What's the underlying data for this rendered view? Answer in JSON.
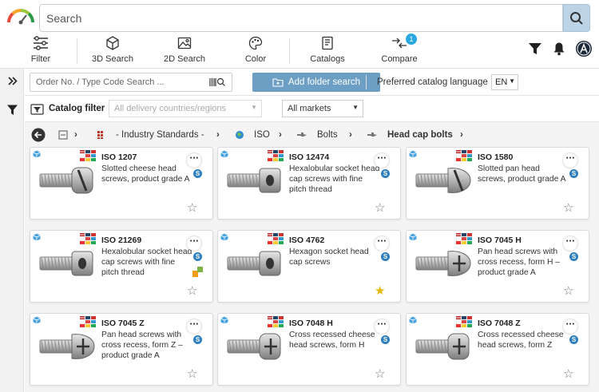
{
  "header": {
    "search_placeholder": "Search"
  },
  "toolbar": {
    "filter": "Filter",
    "search3d": "3D Search",
    "search2d": "2D Search",
    "color": "Color",
    "catalogs": "Catalogs",
    "compare": "Compare",
    "compare_count": "1"
  },
  "order": {
    "placeholder": "Order No. / Type Code Search ..."
  },
  "add_folder": "Add folder search",
  "pref_lang_label": "Preferred catalog language",
  "lang_value": "EN",
  "catalog_filter": {
    "label": "Catalog filter",
    "countries": "All delivery countries/regions",
    "markets": "All markets"
  },
  "breadcrumb": {
    "industry": "- Industry Standards -",
    "iso": "ISO",
    "bolts": "Bolts",
    "current": "Head cap bolts"
  },
  "cards": [
    {
      "title": "ISO 1207",
      "desc": "Slotted cheese head screws, product grade A",
      "head": "cheese-slot",
      "favorite": false,
      "extra_badge": false
    },
    {
      "title": "ISO 12474",
      "desc": "Hexalobular socket head cap screws with fine pitch thread",
      "head": "socket",
      "favorite": false,
      "extra_badge": false
    },
    {
      "title": "ISO 1580",
      "desc": "Slotted pan head screws, product grade A",
      "head": "pan-slot",
      "favorite": false,
      "extra_badge": false
    },
    {
      "title": "ISO 21269",
      "desc": "Hexalobular socket head cap screws with fine pitch thread",
      "head": "socket",
      "favorite": false,
      "extra_badge": true
    },
    {
      "title": "ISO 4762",
      "desc": "Hexagon socket head cap screws",
      "head": "socket",
      "favorite": true,
      "extra_badge": false
    },
    {
      "title": "ISO 7045 H",
      "desc": "Pan head screws with cross recess, form H – product grade A",
      "head": "pan-cross",
      "favorite": false,
      "extra_badge": false
    },
    {
      "title": "ISO 7045 Z",
      "desc": "Pan head screws with cross recess, form Z – product grade A",
      "head": "pan-cross",
      "favorite": false,
      "extra_badge": false
    },
    {
      "title": "ISO 7048 H",
      "desc": "Cross recessed cheese head screws, form H",
      "head": "cheese-cross",
      "favorite": false,
      "extra_badge": false
    },
    {
      "title": "ISO 7048 Z",
      "desc": "Cross recessed cheese head screws, form Z",
      "head": "cheese-cross",
      "favorite": false,
      "extra_badge": false
    }
  ],
  "icons": {
    "more": "more-icon",
    "source_badge": "S",
    "star": "star-icon"
  },
  "colors": {
    "accent": "#6d9fc5",
    "badge": "#2e7fc0",
    "fav": "#e2b800"
  }
}
